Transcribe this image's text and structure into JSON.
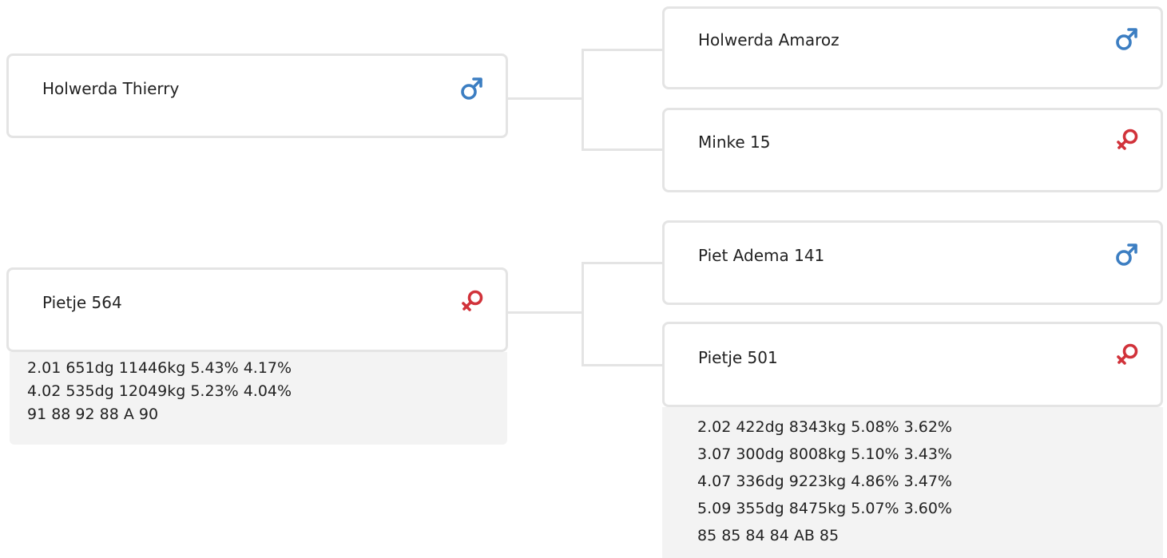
{
  "colors": {
    "male": "#3c7ec2",
    "female": "#d1323a",
    "border": "#e4e4e4",
    "info_bg": "#f3f3f3"
  },
  "parents": {
    "father": {
      "name": "Holwerda Thierry",
      "sex_icon": "male-icon"
    },
    "mother": {
      "name": "Pietje 564",
      "sex_icon": "female-icon",
      "info": [
        "2.01 651dg 11446kg 5.43% 4.17%",
        "4.02 535dg 12049kg 5.23% 4.04%",
        "91 88 92 88 A 90"
      ]
    }
  },
  "grandparents": {
    "paternal_grandfather": {
      "name": "Holwerda Amaroz",
      "sex_icon": "male-icon"
    },
    "paternal_grandmother": {
      "name": "Minke 15",
      "sex_icon": "female-icon"
    },
    "maternal_grandfather": {
      "name": "Piet Adema 141",
      "sex_icon": "male-icon"
    },
    "maternal_grandmother": {
      "name": "Pietje 501",
      "sex_icon": "female-icon",
      "info": [
        "2.02 422dg 8343kg 5.08% 3.62%",
        "3.07 300dg 8008kg 5.10% 3.43%",
        "4.07 336dg 9223kg 4.86% 3.47%",
        "5.09 355dg 8475kg 5.07% 3.60%",
        "85 85 84 84 AB 85"
      ]
    }
  }
}
